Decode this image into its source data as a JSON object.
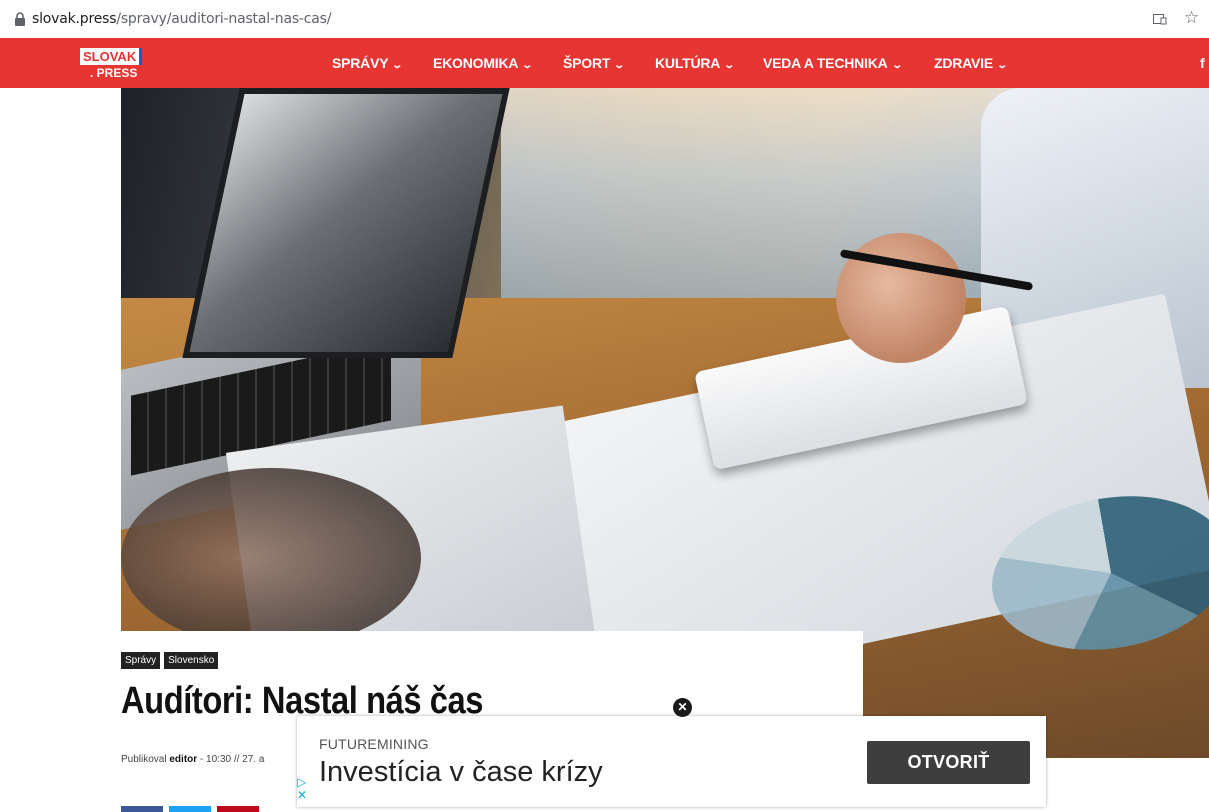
{
  "browser": {
    "url_host": "slovak.press",
    "url_path": "/spravy/auditori-nastal-nas-cas/",
    "lock_icon": "lock-icon",
    "tab_icon": "tab-icon",
    "star_icon": "star-icon"
  },
  "site": {
    "logo_top": "SLOVAK",
    "logo_bottom": ". PRESS",
    "nav": [
      {
        "label": "SPRÁVY"
      },
      {
        "label": "EKONOMIKA"
      },
      {
        "label": "ŠPORT"
      },
      {
        "label": "KULTÚRA"
      },
      {
        "label": "VEDA A TECHNIKA"
      },
      {
        "label": "ZDRAVIE"
      }
    ],
    "social_letter": "f",
    "colors": {
      "brand_red": "#e73534",
      "logo_blue": "#1c5bd6"
    }
  },
  "article": {
    "tags": [
      "Správy",
      "Slovensko"
    ],
    "title": "Audítori: Nastal náš čas",
    "meta_prefix": "Publikoval",
    "author": "editor",
    "meta_rest": "- 10:30 // 27. a"
  },
  "ad": {
    "brand": "FUTUREMINING",
    "headline": "Investícia v čase krízy",
    "cta": "OTVORIŤ",
    "close_glyph": "✕",
    "adchoice_play": "▷",
    "adchoice_close": "✕"
  }
}
